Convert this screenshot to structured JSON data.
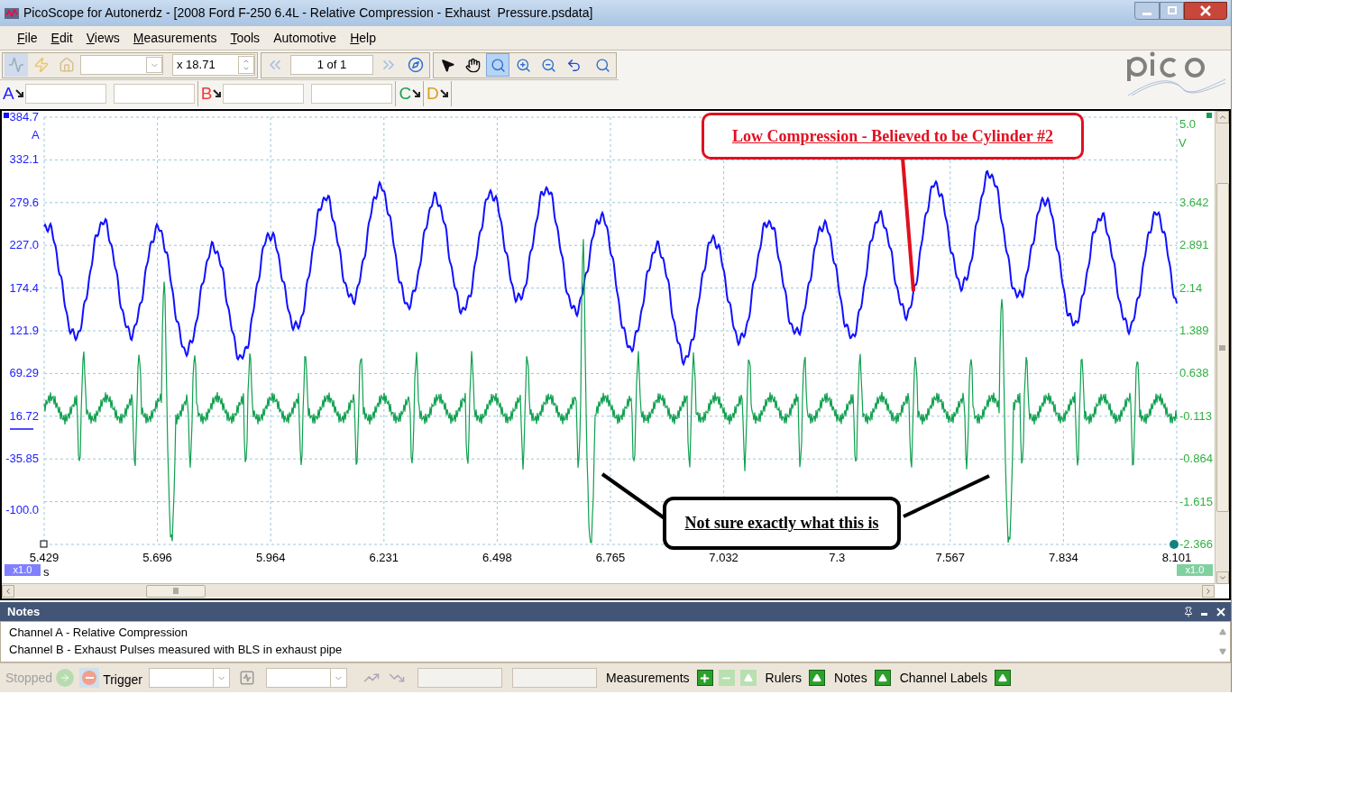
{
  "window": {
    "title": "PicoScope for Autonerdz - [2008 Ford F-250 6.4L - Relative Compression - Exhaust  Pressure.psdata]"
  },
  "menu": [
    {
      "label": "File",
      "mnemonic": true
    },
    {
      "label": "Edit",
      "mnemonic": true
    },
    {
      "label": "Views",
      "mnemonic": true
    },
    {
      "label": "Measurements",
      "mnemonic": true
    },
    {
      "label": "Tools",
      "mnemonic": true
    },
    {
      "label": "Automotive",
      "mnemonic": false
    },
    {
      "label": "Help",
      "mnemonic": true
    }
  ],
  "toolbar": {
    "zoom_factor": "x 18.71",
    "buffer": "1 of 1"
  },
  "channels": [
    {
      "label": "A",
      "color": "#2020ff"
    },
    {
      "label": "B",
      "color": "#f03a3a"
    },
    {
      "label": "C",
      "color": "#20a050"
    },
    {
      "label": "D",
      "color": "#d8a020"
    }
  ],
  "scope": {
    "left_axis": {
      "unit": "A",
      "ticks": [
        "384.7",
        "332.1",
        "279.6",
        "227.0",
        "174.4",
        "121.9",
        "69.29",
        "16.72",
        "-35.85",
        "-100.0"
      ]
    },
    "right_axis": {
      "unit": "V",
      "ticks": [
        "5.0",
        "3.642",
        "2.891",
        "2.14",
        "1.389",
        "0.638",
        "-0.113",
        "-0.864",
        "-1.615",
        "-2.366"
      ]
    },
    "x_ticks": [
      "5.429",
      "5.696",
      "5.964",
      "6.231",
      "6.498",
      "6.765",
      "7.032",
      "7.3",
      "7.567",
      "7.834",
      "8.101"
    ],
    "x_unit": "s",
    "left_zoom": "x1.0",
    "right_zoom": "x1.0",
    "annotations": [
      {
        "kind": "red",
        "text": "Low Compression - Believed to be Cylinder #2"
      },
      {
        "kind": "black",
        "text": "Not sure exactly what this is"
      }
    ]
  },
  "notes": {
    "title": "Notes",
    "lines": [
      "Channel A - Relative Compression",
      "Channel B - Exhaust Pulses measured with BLS in exhaust pipe"
    ]
  },
  "status_bar": {
    "state": "Stopped",
    "trigger": "Trigger",
    "toggles": [
      "Measurements",
      "Rulers",
      "Notes",
      "Channel Labels"
    ]
  }
}
